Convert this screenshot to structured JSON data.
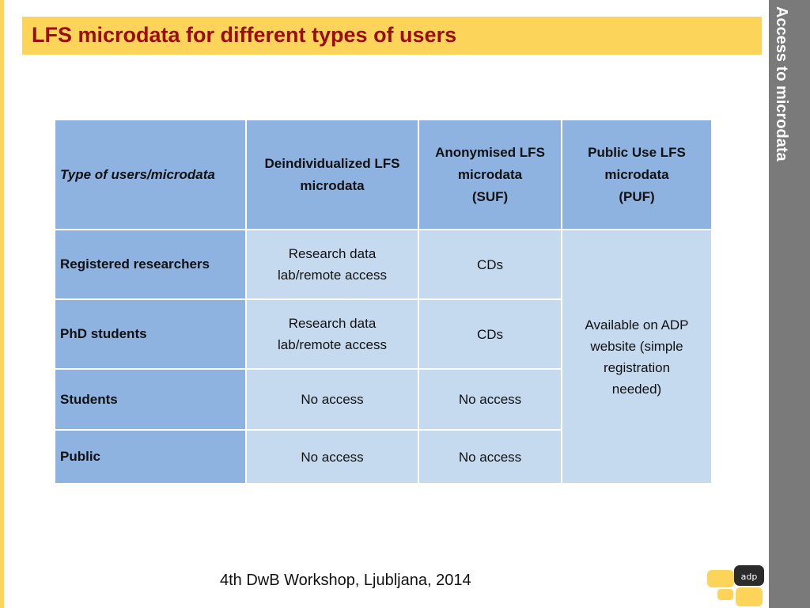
{
  "slide": {
    "title": "LFS microdata for different types of users",
    "side_label": "Access to microdata",
    "footer": "4th DwB Workshop, Ljubljana, 2014",
    "logo_text": "adp"
  },
  "table": {
    "headers": [
      "Type of users/microdata",
      "Deindividualized LFS microdata",
      "Anonymised LFS microdata (SUF)",
      "Public Use LFS microdata (PUF)"
    ],
    "header_lines": {
      "col1": [
        "Deindividualized LFS",
        "microdata"
      ],
      "col2": [
        "Anonymised LFS",
        "microdata",
        "(SUF)"
      ],
      "col3": [
        "Public Use LFS",
        "microdata",
        "(PUF)"
      ]
    },
    "rows": [
      {
        "user": "Registered researchers",
        "deindividualized": [
          "Research data",
          "lab/remote access"
        ],
        "anonymised": "CDs"
      },
      {
        "user": "PhD students",
        "deindividualized": [
          "Research data",
          "lab/remote access"
        ],
        "anonymised": "CDs"
      },
      {
        "user": "Students",
        "deindividualized": [
          "No access"
        ],
        "anonymised": "No access"
      },
      {
        "user": "Public",
        "deindividualized": [
          "No access"
        ],
        "anonymised": "No access"
      }
    ],
    "puf_merged_lines": [
      "Available on ADP",
      "website (simple",
      "registration",
      "needed)"
    ]
  },
  "colors": {
    "accent_yellow": "#fcd45a",
    "title_red": "#9b0d0d",
    "header_blue": "#8eb3e0",
    "cell_light_blue": "#c5d9ef",
    "side_gray": "#7a7a7a"
  }
}
